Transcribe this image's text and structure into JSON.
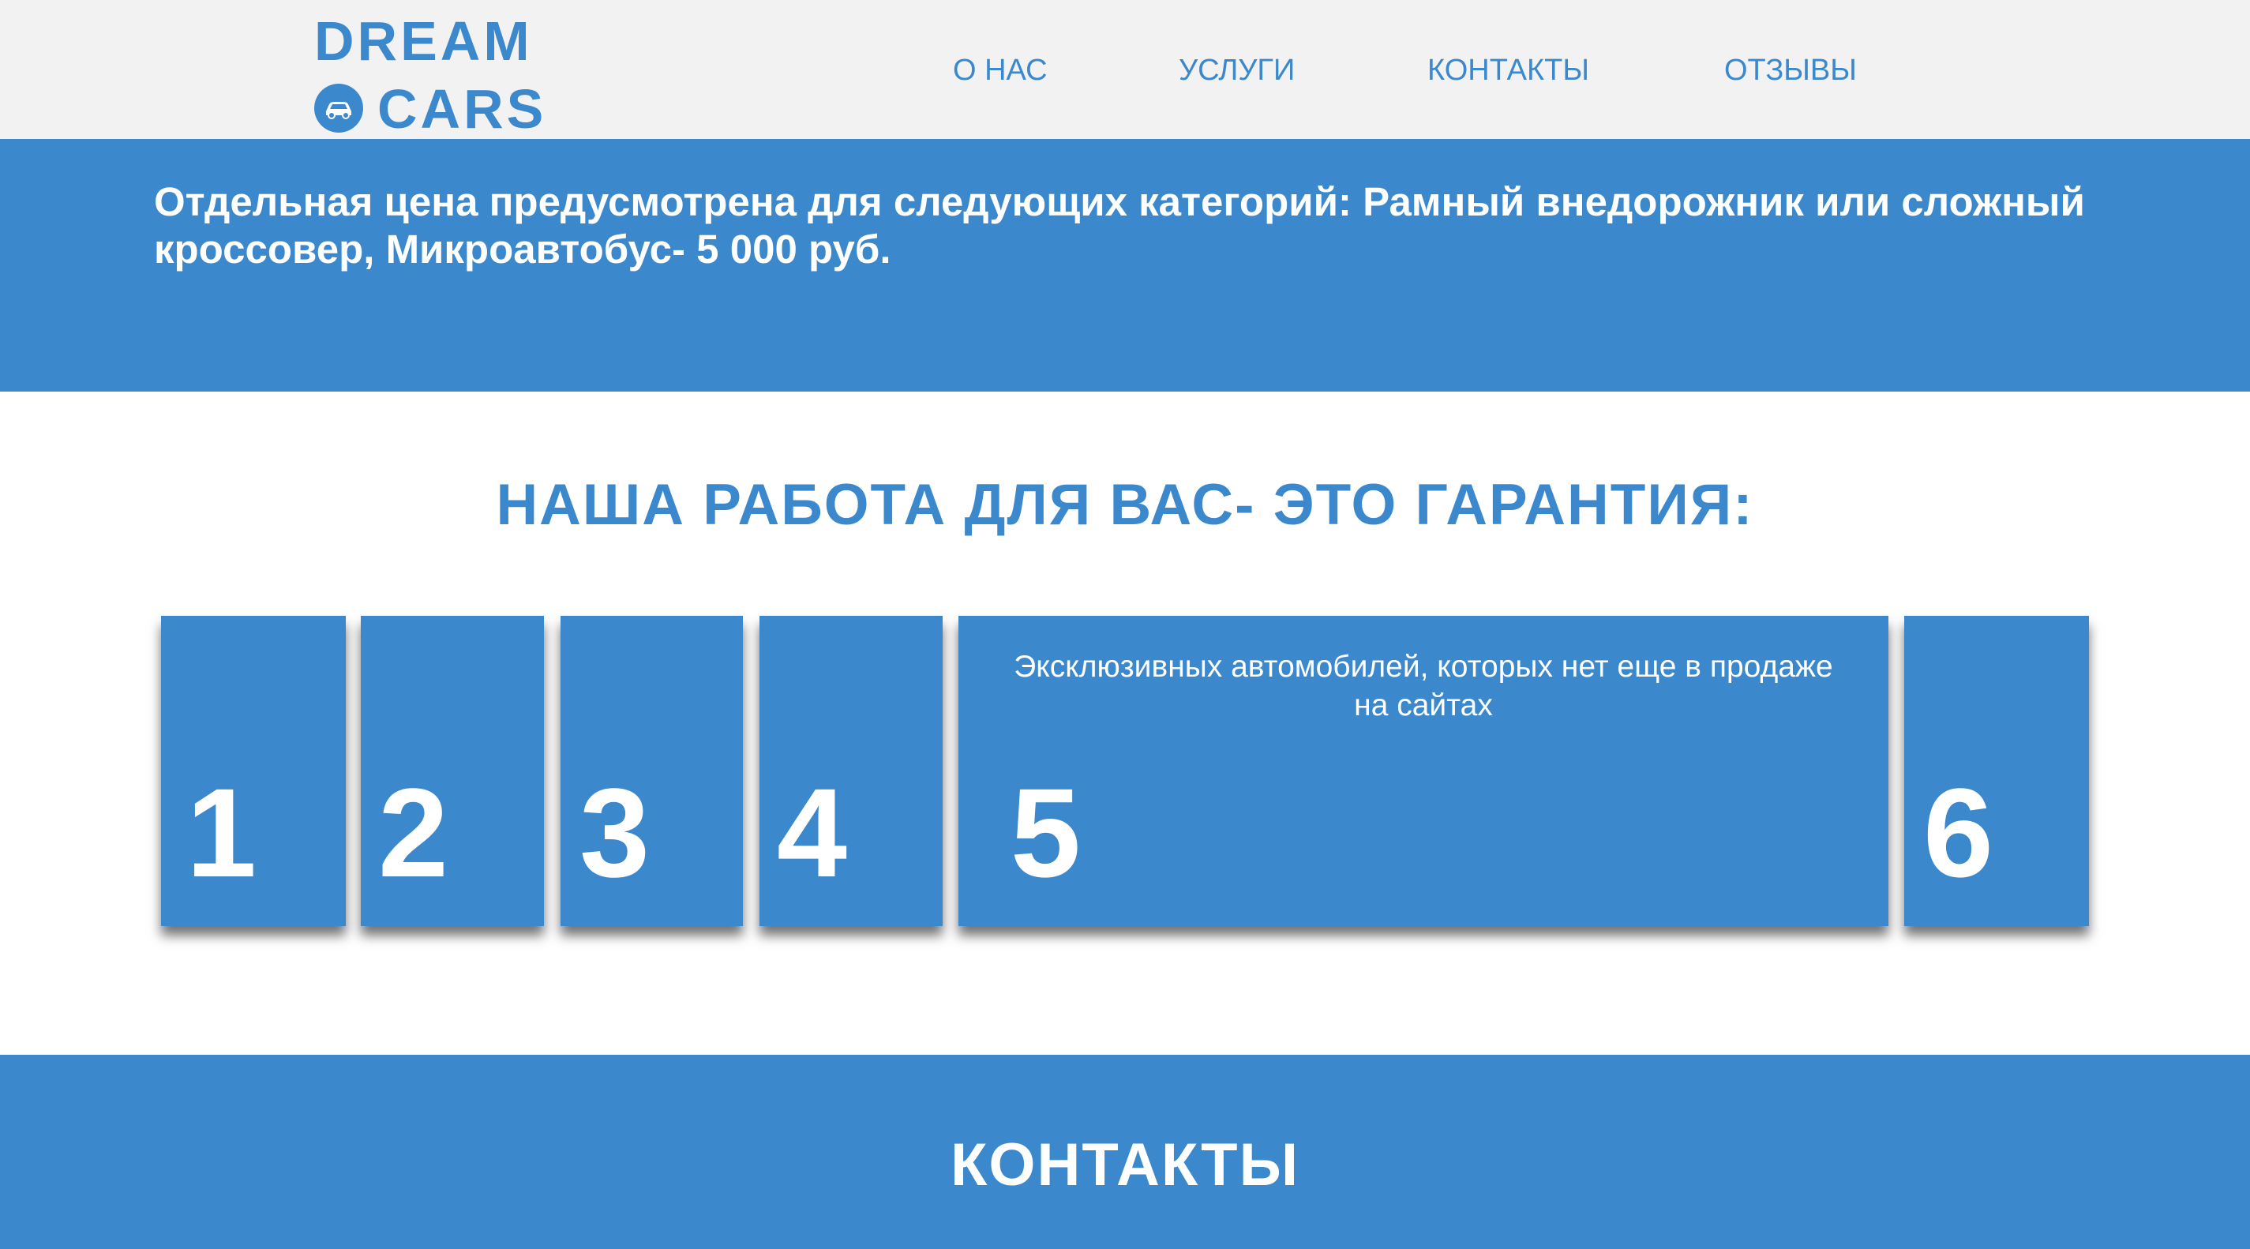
{
  "header": {
    "logo": {
      "line1": "DREAM",
      "line2": "CARS",
      "emblem_icon": "car-emblem-icon"
    },
    "nav": [
      {
        "label": "О НАС"
      },
      {
        "label": "УСЛУГИ"
      },
      {
        "label": "КОНТАКТЫ"
      },
      {
        "label": "ОТЗЫВЫ"
      }
    ]
  },
  "price_note": "Отдельная цена предусмотрена для следующих категорий: Рамный внедорожник или сложный кроссовер, Микроавтобус- 5 000 руб.",
  "guarantee": {
    "title": "НАША РАБОТА ДЛЯ ВАС- ЭТО ГАРАНТИЯ:",
    "cards": [
      {
        "number": "1",
        "description": ""
      },
      {
        "number": "2",
        "description": ""
      },
      {
        "number": "3",
        "description": ""
      },
      {
        "number": "4",
        "description": ""
      },
      {
        "number": "5",
        "description": "Эксклюзивных автомобилей, которых нет еще в продаже на сайтах"
      },
      {
        "number": "6",
        "description": ""
      }
    ]
  },
  "contacts": {
    "title": "КОНТАКТЫ"
  },
  "colors": {
    "accent": "#3b88cc",
    "header_bg": "#f2f2f2",
    "text_on_accent": "#ffffff"
  }
}
